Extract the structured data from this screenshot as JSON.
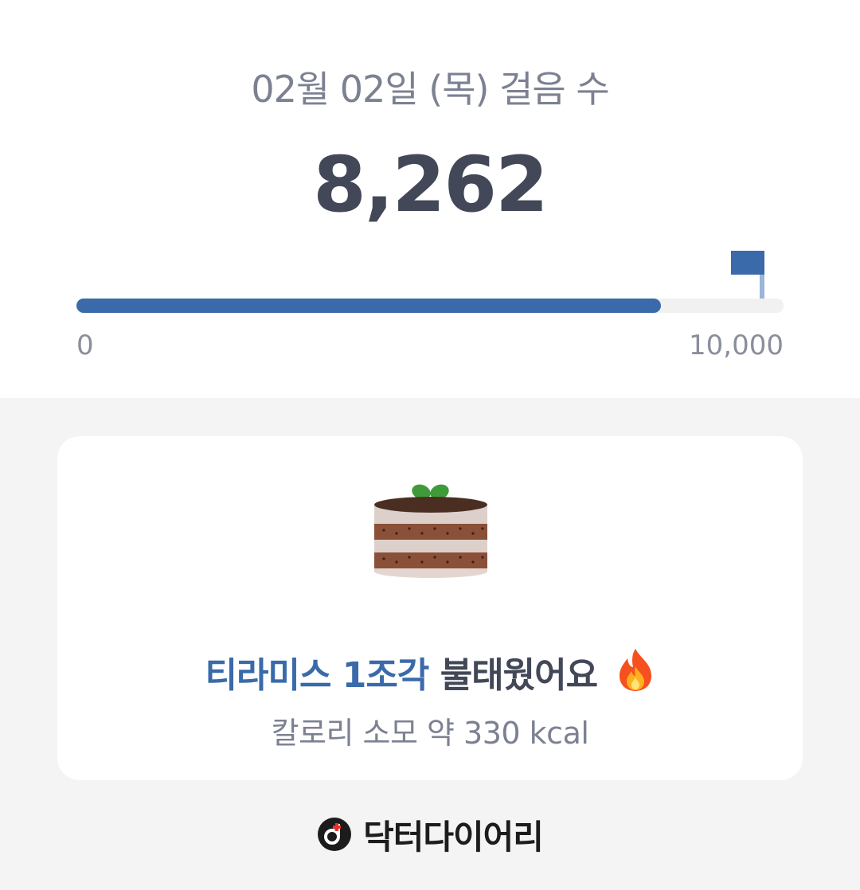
{
  "steps": {
    "date_title": "02월 02일 (목) 걸음 수",
    "count": "8,262",
    "progress_fraction": 0.8262,
    "scale_min": "0",
    "scale_max": "10,000"
  },
  "card": {
    "food_icon": "tiramisu-cake-icon",
    "food_label": "티라미스 1조각",
    "burn_suffix": "불태웠어요",
    "fire_icon": "fire-icon",
    "calorie_text": "칼로리 소모 약 330 kcal"
  },
  "brand": {
    "logo_icon": "doctor-diary-logo-icon",
    "name": "닥터다이어리"
  },
  "colors": {
    "accent": "#3a6aa9",
    "track": "#f1f1f1",
    "text_dark": "#434858",
    "text_muted": "#7c8192",
    "background": "#f4f4f4"
  }
}
